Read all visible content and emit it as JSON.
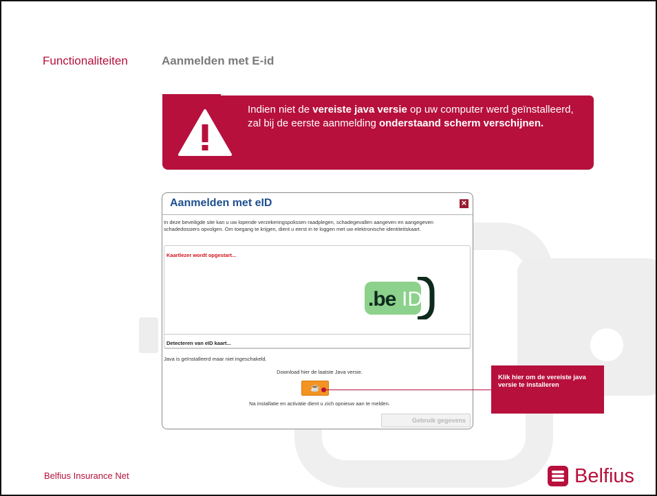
{
  "page": {
    "section": "Functionaliteiten",
    "title": "Aanmelden met E-id"
  },
  "warning": {
    "icon": "warning-triangle-icon",
    "text_parts": {
      "p1": "Indien niet de ",
      "b1": "vereiste java versie",
      "p2": " op uw computer werd geïnstalleerd, zal bij de eerste aanmelding ",
      "b2": "onderstaand scherm verschijnen."
    },
    "background_color": "#b7103d"
  },
  "dialog": {
    "title": "Aanmelden met eID",
    "close_icon": "close-icon",
    "intro": "In deze beveiligde site kan u uw lopende verzekeringspolissen raadplegen, schadegevallen aangeven en aangegeven schadedossiers opvolgen. Om toegang te krijgen, dient u eerst in te loggen met uw elektronische identiteitskaart.",
    "reader_status": "Kaartlezer wordt opgestart...",
    "logo_text": ".beID",
    "detect_label": "Detecteren van eID kaart...",
    "java_status": "Java is geïnstalleerd maar niet ingeschakeld.",
    "download_text": "Download hier de laatste Java versie.",
    "java_button_icon": "java-cup-icon",
    "after_install": "Na installatie en activatie dient u zich opnieuw aan te melden.",
    "use_button": "Gebruik gegevens"
  },
  "callout": {
    "text": "Klik hier om de vereiste java versie te installeren"
  },
  "footer": {
    "left": "Belfius Insurance Net",
    "brand": "Belfius"
  },
  "colors": {
    "brand": "#b7103d",
    "dialog_title": "#1d4f91",
    "java_button": "#f39422"
  }
}
